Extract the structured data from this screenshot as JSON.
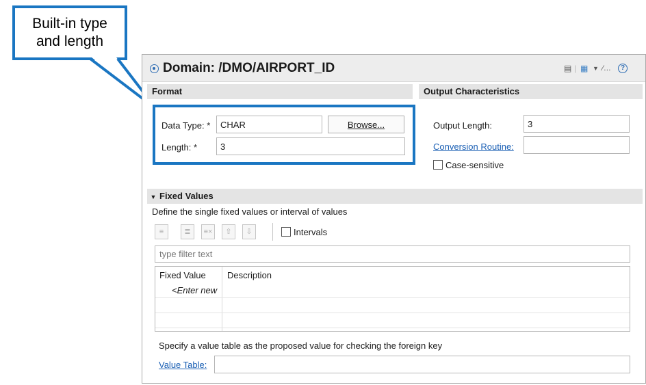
{
  "callout": {
    "text": "Built-in type\nand length",
    "color": "#1a76c2"
  },
  "editor": {
    "title": "Domain: /DMO/AIRPORT_ID",
    "toolbar_icons": [
      "document-icon",
      "link-icon",
      "dropdown-icon",
      "edit-icon",
      "help-icon"
    ]
  },
  "format": {
    "header": "Format",
    "data_type_label": "Data Type: *",
    "data_type_value": "CHAR",
    "browse_label": "Browse...",
    "length_label": "Length: *",
    "length_value": "3"
  },
  "output": {
    "header": "Output Characteristics",
    "output_length_label": "Output Length:",
    "output_length_value": "3",
    "conversion_routine_label": "Conversion Routine:",
    "conversion_routine_value": "",
    "case_sensitive_label": "Case-sensitive",
    "case_sensitive_checked": false
  },
  "fixed_values": {
    "header": "Fixed Values",
    "description": "Define the single fixed values or interval of values",
    "intervals_label": "Intervals",
    "intervals_checked": false,
    "filter_placeholder": "type filter text",
    "columns": [
      "Fixed Value",
      "Description"
    ],
    "enter_new": "<Enter new"
  },
  "value_table": {
    "hint": "Specify a value table as the proposed value for checking the foreign key",
    "label": "Value Table:",
    "value": ""
  }
}
